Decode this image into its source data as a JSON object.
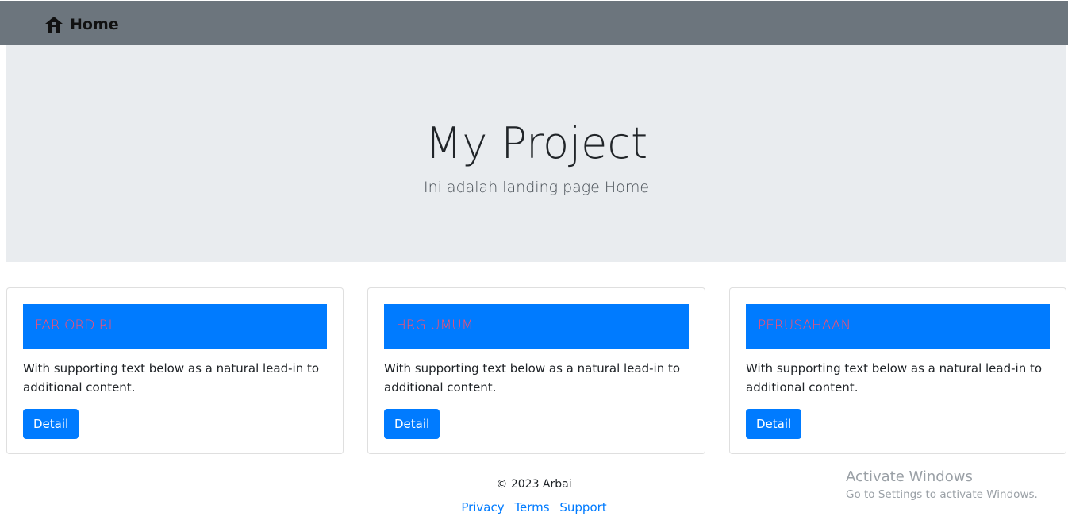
{
  "navbar": {
    "brand_icon": "home-icon",
    "brand_label": "Home",
    "colors": {
      "background": "#6c757d"
    }
  },
  "hero": {
    "title": "My Project",
    "subtitle": "Ini adalah landing page Home",
    "colors": {
      "background": "#e9ecef"
    }
  },
  "cards": [
    {
      "header": "FAR ORD RI",
      "text": "With supporting text below as a natural lead-in to additional content.",
      "button": "Detail"
    },
    {
      "header": "HRG UMUM",
      "text": "With supporting text below as a natural lead-in to additional content.",
      "button": "Detail"
    },
    {
      "header": "PERUSAHAAN",
      "text": "With supporting text below as a natural lead-in to additional content.",
      "button": "Detail"
    }
  ],
  "colors": {
    "accent": "#007bff",
    "card_header_text": "#ff4d6d"
  },
  "footer": {
    "copyright": "© 2023 Arbai",
    "links": [
      "Privacy",
      "Terms",
      "Support"
    ]
  },
  "watermark": {
    "title": "Activate Windows",
    "subtitle": "Go to Settings to activate Windows."
  }
}
